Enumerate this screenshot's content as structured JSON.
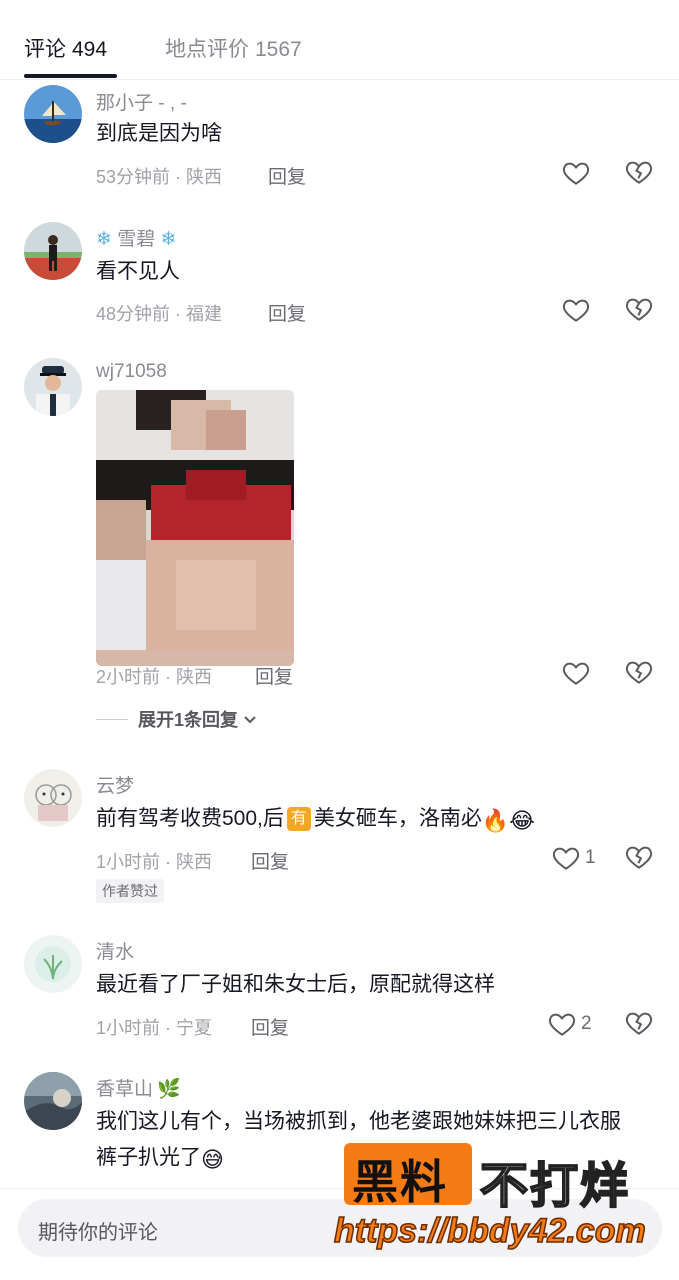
{
  "tabs": [
    {
      "label": "评论",
      "count": "494"
    },
    {
      "label": "地点评价",
      "count": "1567"
    }
  ],
  "comments": [
    {
      "username": "那小子  - , -",
      "content": "到底是因为啥",
      "time": "53分钟前",
      "location": "陕西",
      "reply": "回复",
      "likes": ""
    },
    {
      "username": "雪碧",
      "username_decor": "❄",
      "content": "看不见人",
      "time": "48分钟前",
      "location": "福建",
      "reply": "回复",
      "likes": ""
    },
    {
      "username": "wj71058",
      "content": "",
      "time": "2小时前",
      "location": "陕西",
      "reply": "回复",
      "likes": "",
      "expand": "展开1条回复"
    },
    {
      "username": "云梦",
      "content_before": "前有驾考收费500,后",
      "badge": "有",
      "content_after": "美女砸车，洛南必",
      "time": "1小时前",
      "location": "陕西",
      "reply": "回复",
      "likes": "1",
      "author_tag": "作者赞过"
    },
    {
      "username": "清水",
      "content": "最近看了厂子姐和朱女士后，原配就得这样",
      "time": "1小时前",
      "location": "宁夏",
      "reply": "回复",
      "likes": "2"
    },
    {
      "username": "香草山",
      "content": "我们这儿有个，当场被抓到，他老婆跟她妹妹把三儿衣服裤子扒光了"
    }
  ],
  "input": {
    "placeholder": "期待你的评论"
  },
  "watermark": {
    "part1": "黑料",
    "part2": "不打烊",
    "url": "https://bbdy42.com"
  }
}
